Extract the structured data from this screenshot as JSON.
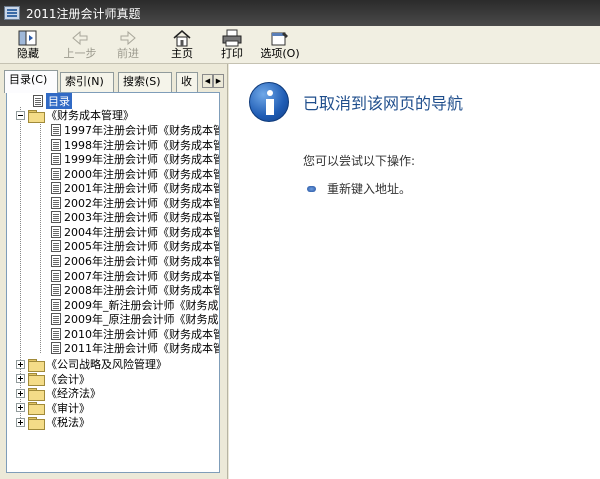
{
  "window": {
    "title": "2011注册会计师真题"
  },
  "toolbar": {
    "hide_label": "隐藏",
    "back_label": "上一步",
    "forward_label": "前进",
    "home_label": "主页",
    "print_label": "打印",
    "options_label": "选项(O)"
  },
  "tabs": [
    {
      "label": "目录(C)"
    },
    {
      "label": "索引(N)"
    },
    {
      "label": "搜索(S)"
    },
    {
      "label": "收"
    }
  ],
  "tree": {
    "root_label": "目录",
    "group_expanded": "《财务成本管理》",
    "items": [
      "1997年注册会计师《财务成本管",
      "1998年注册会计师《财务成本管",
      "1999年注册会计师《财务成本管",
      "2000年注册会计师《财务成本管",
      "2001年注册会计师《财务成本管",
      "2002年注册会计师《财务成本管",
      "2003年注册会计师《财务成本管",
      "2004年注册会计师《财务成本管",
      "2005年注册会计师《财务成本管",
      "2006年注册会计师《财务成本管",
      "2007年注册会计师《财务成本管",
      "2008年注册会计师《财务成本管",
      "2009年_新注册会计师《财务成",
      "2009年_原注册会计师《财务成",
      "2010年注册会计师《财务成本管",
      "2011年注册会计师《财务成本管"
    ],
    "groups_collapsed": [
      "《公司战略及风险管理》",
      "《会计》",
      "《经济法》",
      "《审计》",
      "《税法》"
    ]
  },
  "content": {
    "title": "已取消到该网页的导航",
    "hint": "您可以尝试以下操作:",
    "option": "重新键入地址。"
  },
  "colors": {
    "accent": "#1f4e8c",
    "selection": "#316ac5"
  }
}
